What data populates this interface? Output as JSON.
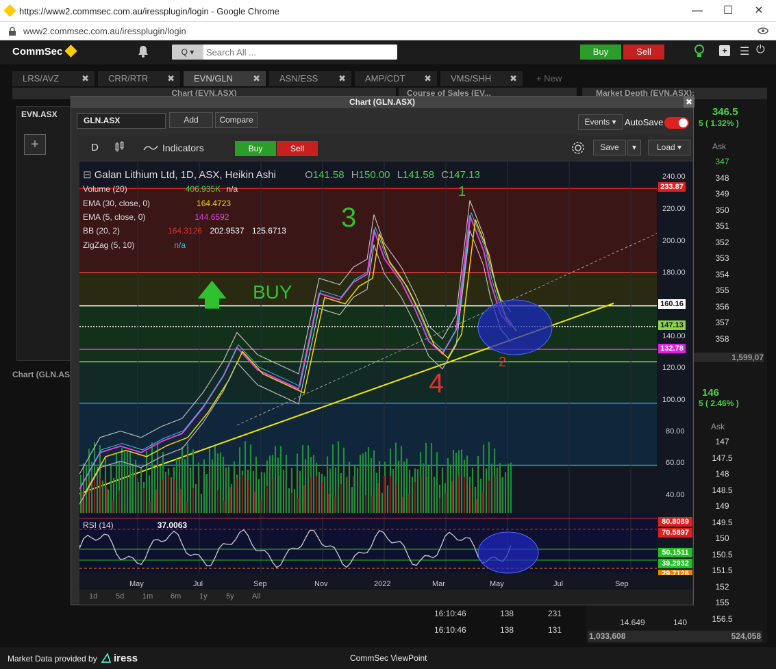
{
  "browser": {
    "title": "https://www2.commsec.com.au/iressplugin/login - Google Chrome",
    "url": "www2.commsec.com.au/iressplugin/login",
    "minimize": "—",
    "maximize": "☐",
    "close": "✕"
  },
  "app": {
    "logo": "CommSec",
    "search_placeholder": "Search All ...",
    "search_button": "Q ▾",
    "buy": "Buy",
    "sell": "Sell"
  },
  "tabs": [
    {
      "label": "LRS/AVZ"
    },
    {
      "label": "CRR/RTR"
    },
    {
      "label": "EVN/GLN"
    },
    {
      "label": "ASN/ESS"
    },
    {
      "label": "AMP/CDT"
    },
    {
      "label": "VMS/SHH"
    }
  ],
  "new_tab": "+ New",
  "panels": {
    "chart_evn": "Chart (EVN.ASX)",
    "course": "Course of Sales (EV...",
    "depth": "Market Depth (EVN.ASX):",
    "evn_code": "EVN.ASX",
    "chart_gln_tab": "Chart (GLN.ASX)"
  },
  "depth": {
    "price1": "346.5",
    "chg1": "5 ( 1.32% )",
    "ask_hdr": "Ask",
    "asks": [
      "347",
      "348",
      "349",
      "350",
      "351",
      "352",
      "353",
      "354",
      "355",
      "356",
      "357",
      "358"
    ],
    "total1": "1,599,07",
    "price2": "146",
    "chg2": "5 ( 2.46% )",
    "ask_hdr2": "Ask",
    "asks2": [
      "147",
      "147.5",
      "148",
      "148.5",
      "149",
      "149.5",
      "150",
      "150.5",
      "151.5",
      "152",
      "155",
      "156.5"
    ],
    "bottom_vals": [
      "14.649",
      "140"
    ],
    "total2a": "1,033,608",
    "total2b": "524,058"
  },
  "sales": {
    "rows": [
      {
        "time": "16:10:46",
        "price": "138",
        "vol": "231"
      },
      {
        "time": "16:10:46",
        "price": "138",
        "vol": "131"
      }
    ]
  },
  "chartwin": {
    "title": "Chart (GLN.ASX)",
    "symbol": "GLN.ASX",
    "add": "Add",
    "compare": "Compare",
    "events": "Events ▾",
    "autosave": "AutoSave"
  },
  "toolbar": {
    "interval": "D",
    "indicators": "Indicators",
    "buy": "Buy",
    "sell": "Sell",
    "save": "Save",
    "load": "Load ▾"
  },
  "legend": {
    "title": "Galan Lithium Ltd, 1D, ASX, Heikin Ashi",
    "o": "O",
    "o_val": "141.58",
    "h": "H",
    "h_val": "150.00",
    "l": "L",
    "l_val": "141.58",
    "c": "C",
    "c_val": "147.13",
    "vol": "Volume (20)",
    "vol_val": "406.935K",
    "vol_na": "n/a",
    "ema30": "EMA (30, close, 0)",
    "ema30_val": "164.4723",
    "ema5": "EMA (5, close, 0)",
    "ema5_val": "144.6592",
    "bb": "BB (20, 2)",
    "bb_v1": "164.3126",
    "bb_v2": "202.9537",
    "bb_v3": "125.6713",
    "zz": "ZigZag (5, 10)",
    "zz_val": "n/a"
  },
  "annotations": {
    "buy": "BUY",
    "w1": "1",
    "w2": "2",
    "w3": "3",
    "w4": "4"
  },
  "price_axis": [
    "240.00",
    "220.00",
    "200.00",
    "180.00",
    "140.00",
    "120.00",
    "100.00",
    "80.00",
    "60.00",
    "40.00"
  ],
  "price_labels": {
    "high": "233.87",
    "line": "160.16",
    "last": "147.13",
    "low": "132.78"
  },
  "rsi": {
    "label": "RSI (14)",
    "val": "37.0063",
    "l1": "80.8089",
    "l2": "70.5897",
    "l3": "50.1511",
    "l4": "39.2932",
    "l5": "29.7126"
  },
  "time_axis": [
    "May",
    "Jul",
    "Sep",
    "Nov",
    "2022",
    "Mar",
    "May",
    "Jul",
    "Sep"
  ],
  "ranges": [
    "1d",
    "5d",
    "1m",
    "6m",
    "1y",
    "5y",
    "All"
  ],
  "colors": {
    "buy": "#2a9d2a",
    "sell": "#c62020",
    "accent": "#ffcc00"
  },
  "footer": {
    "provided": "Market Data provided by",
    "brand": "iress",
    "viewpoint": "CommSec ViewPoint"
  }
}
